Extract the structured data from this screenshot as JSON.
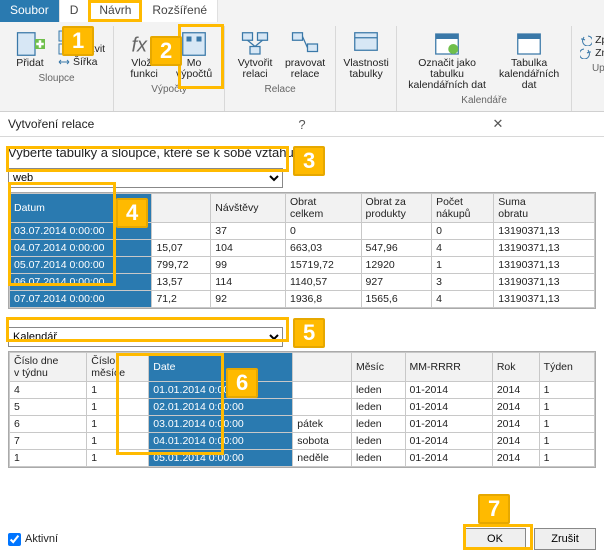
{
  "tabs": {
    "soubor": "Soubor",
    "d": "D",
    "navrh": "Návrh",
    "rozsirene": "Rozšířené"
  },
  "ribbon": {
    "sloupce": {
      "pridat": "Přidat",
      "ukotvit": "Ukotvit",
      "sirka": "Šířka",
      "label": "Sloupce"
    },
    "vypocty": {
      "vlozit_funkci": "Vložit\nfunkci",
      "mo_vypoctu": "Mo\nvýpočtů",
      "label": "Výpočty"
    },
    "relace": {
      "vytvorit": "Vytvořit\nrelaci",
      "upravovat": "pravovat\nrelace",
      "label": "Relace"
    },
    "mid": {
      "vlastnosti": "Vlastnosti\ntabulky"
    },
    "kalendare": {
      "oznacit": "Označit jako tabulku\nkalendářních dat",
      "tabulka": "Tabulka\nkalendářních dat",
      "label": "Kalendáře"
    },
    "upravit": {
      "zpet": "Zpět",
      "znovu": "Znovu",
      "label": "Upravit"
    }
  },
  "dialog": {
    "title": "Vytvoření relace",
    "prompt": "Vyberte tabulky a sloupce, které se k sobě vztahují.",
    "combo1": "web",
    "combo2": "Kalendář",
    "ok": "OK",
    "cancel": "Zrušit",
    "active": "Aktivní"
  },
  "callouts": {
    "c1": "1",
    "c2": "2",
    "c3": "3",
    "c4": "4",
    "c5": "5",
    "c6": "6",
    "c7": "7"
  },
  "grid1": {
    "headers": [
      "Datum",
      "",
      "Návštěvy",
      "Obrat\ncelkem",
      "Obrat za\nprodukty",
      "Počet\nnákupů",
      "Suma\nobratu"
    ],
    "rows": [
      [
        "03.07.2014 0:00:00",
        "",
        "37",
        "0",
        "",
        "0",
        "13190371,13"
      ],
      [
        "04.07.2014 0:00:00",
        "15,07",
        "104",
        "663,03",
        "547,96",
        "4",
        "13190371,13"
      ],
      [
        "05.07.2014 0:00:00",
        "799,72",
        "99",
        "15719,72",
        "12920",
        "1",
        "13190371,13"
      ],
      [
        "06.07.2014 0:00:00",
        "13,57",
        "114",
        "1140,57",
        "927",
        "3",
        "13190371,13"
      ],
      [
        "07.07.2014 0:00:00",
        "71,2",
        "92",
        "1936,8",
        "1565,6",
        "4",
        "13190371,13"
      ]
    ]
  },
  "grid2": {
    "headers": [
      "Číslo dne\nv týdnu",
      "Číslo\nměsíce",
      "Date",
      "",
      "Měsíc",
      "MM-RRRR",
      "Rok",
      "Týden"
    ],
    "rows": [
      [
        "4",
        "1",
        "01.01.2014 0:00:00",
        "",
        "leden",
        "01-2014",
        "2014",
        "1"
      ],
      [
        "5",
        "1",
        "02.01.2014 0:00:00",
        "",
        "leden",
        "01-2014",
        "2014",
        "1"
      ],
      [
        "6",
        "1",
        "03.01.2014 0:00:00",
        "pátek",
        "leden",
        "01-2014",
        "2014",
        "1"
      ],
      [
        "7",
        "1",
        "04.01.2014 0:00:00",
        "sobota",
        "leden",
        "01-2014",
        "2014",
        "1"
      ],
      [
        "1",
        "1",
        "05.01.2014 0:00:00",
        "neděle",
        "leden",
        "01-2014",
        "2014",
        "1"
      ]
    ]
  }
}
